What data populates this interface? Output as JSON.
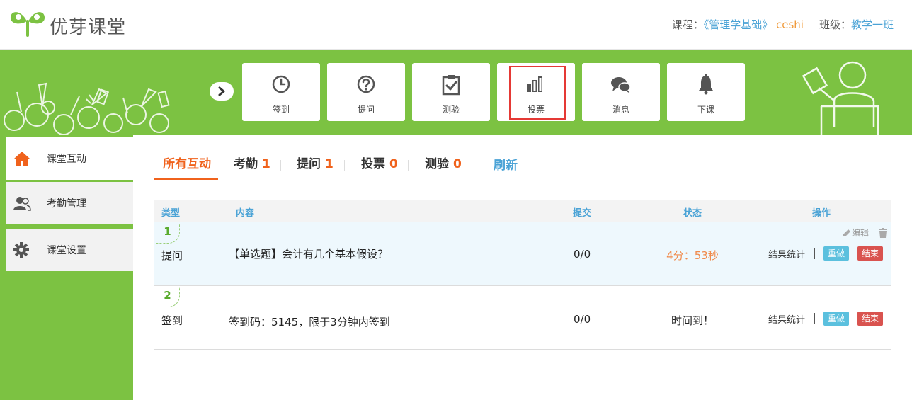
{
  "app": {
    "logo_text": "优芽课堂"
  },
  "course_info": {
    "course_label": "课程：",
    "course_name": "《管理学基础》",
    "course_user": "ceshi",
    "class_label": "班级：",
    "class_name": "教学一班"
  },
  "toolbar": {
    "items": [
      {
        "label": "签到",
        "icon": "clock-icon"
      },
      {
        "label": "提问",
        "icon": "question-icon"
      },
      {
        "label": "测验",
        "icon": "clipboard-check-icon"
      },
      {
        "label": "投票",
        "icon": "bar-chart-icon",
        "selected": true
      },
      {
        "label": "消息",
        "icon": "chat-bubbles-icon"
      },
      {
        "label": "下课",
        "icon": "bell-icon"
      }
    ]
  },
  "sidebar": {
    "items": [
      {
        "label": "课堂互动",
        "icon": "home-icon",
        "active": true
      },
      {
        "label": "考勤管理",
        "icon": "users-icon"
      },
      {
        "label": "课堂设置",
        "icon": "gear-icon"
      }
    ]
  },
  "tabs": {
    "items": [
      {
        "label": "所有互动",
        "count": ""
      },
      {
        "label": "考勤",
        "count": "1"
      },
      {
        "label": "提问",
        "count": "1"
      },
      {
        "label": "投票",
        "count": "0"
      },
      {
        "label": "测验",
        "count": "0"
      }
    ],
    "refresh_label": "刷新"
  },
  "table": {
    "headers": {
      "type": "类型",
      "content": "内容",
      "submit": "提交",
      "status": "状态",
      "ops": "操作"
    },
    "edit_label": "编辑",
    "rows": [
      {
        "num": "1",
        "type": "提问",
        "content": "【单选题】会计有几个基本假设？",
        "submit": "0/0",
        "status": "4分：53秒",
        "stat_label": "结果统计",
        "redo_label": "重做",
        "end_label": "结束"
      },
      {
        "num": "2",
        "type": "签到",
        "content": "签到码：5145，限于3分钟内签到",
        "submit": "0/0",
        "status": "时间到！",
        "stat_label": "结果统计",
        "redo_label": "重做",
        "end_label": "结束"
      }
    ]
  },
  "colors": {
    "brand_green": "#7cc242",
    "accent_orange": "#f0621c",
    "link_blue": "#4ba3d6"
  }
}
